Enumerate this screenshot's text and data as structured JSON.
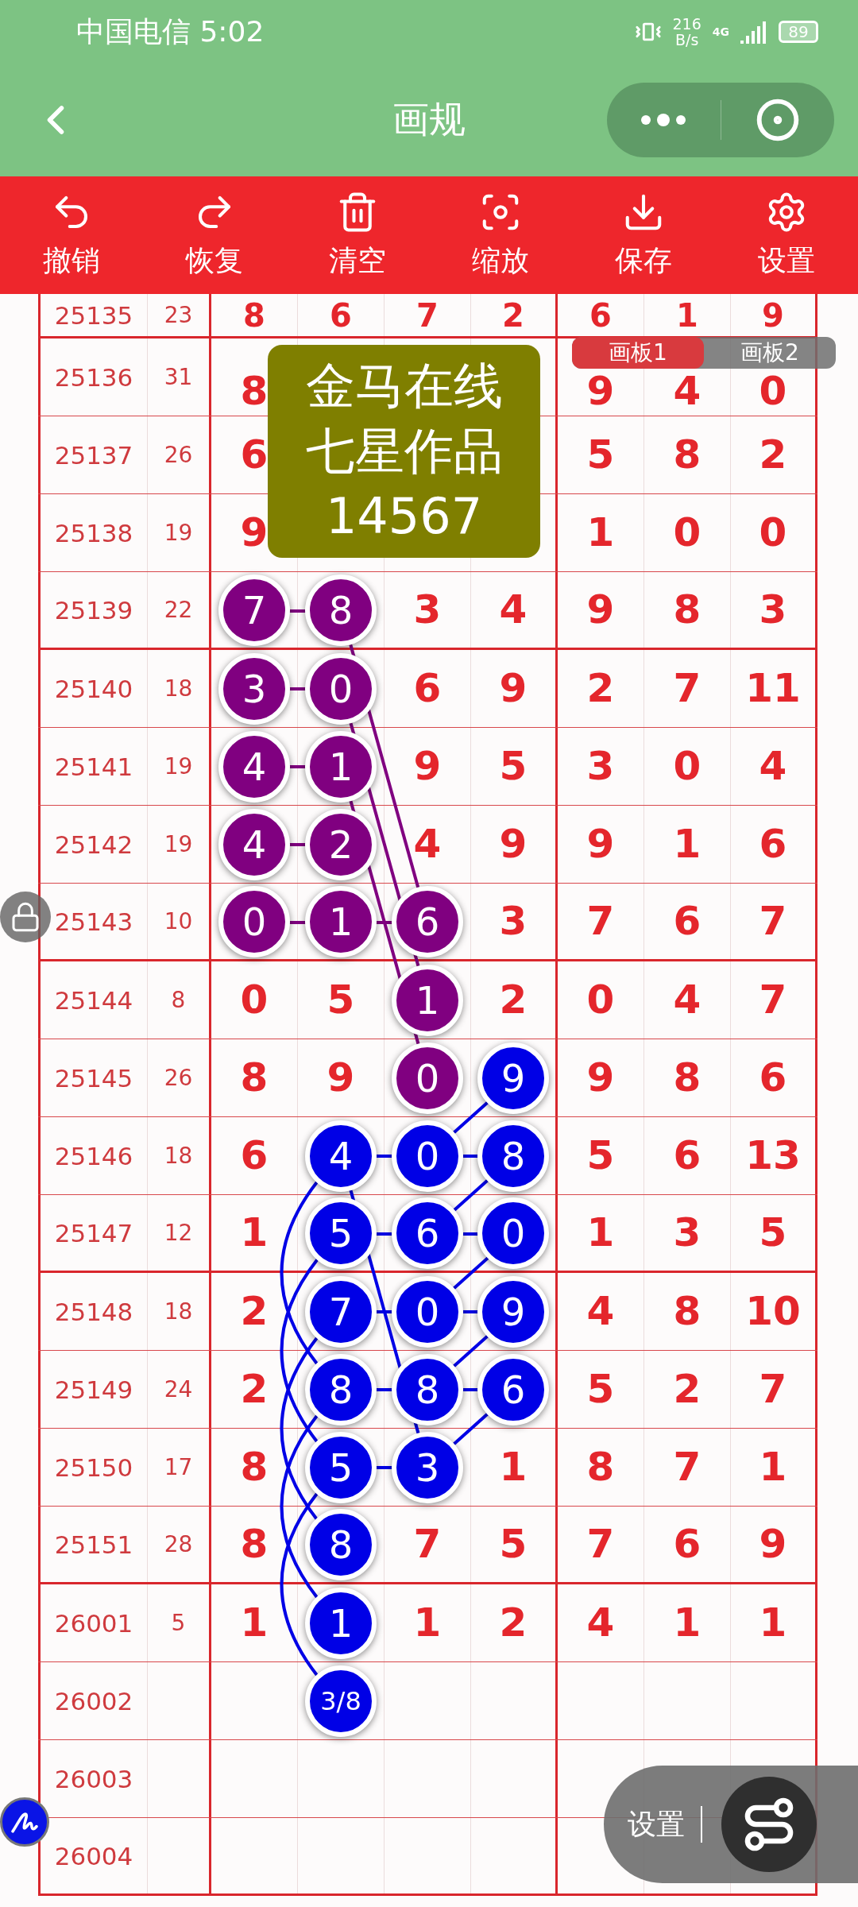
{
  "status_bar": {
    "carrier_time": "中国电信 5:02",
    "speed": "216",
    "speed_unit": "B/s",
    "network": "4G",
    "battery": "89"
  },
  "title_bar": {
    "title": "画规"
  },
  "toolbar": [
    {
      "kind": "undo",
      "label": "撤销"
    },
    {
      "kind": "redo",
      "label": "恢复"
    },
    {
      "kind": "clear",
      "label": "清空"
    },
    {
      "kind": "zoom",
      "label": "缩放"
    },
    {
      "kind": "save",
      "label": "保存"
    },
    {
      "kind": "settings",
      "label": "设置"
    }
  ],
  "board_tabs": [
    {
      "label": "画板1",
      "selected": true
    },
    {
      "label": "画板2",
      "selected": false
    }
  ],
  "note_card": {
    "lines": [
      "金马在线",
      "七星作品",
      "14567"
    ]
  },
  "rows": [
    {
      "issue": "25135",
      "sum": "23",
      "cells": [
        {
          "value": "8"
        },
        {
          "value": "6"
        },
        {
          "value": "7"
        },
        {
          "value": "2"
        },
        {
          "value": "6"
        },
        {
          "value": "1"
        },
        {
          "value": "9"
        }
      ]
    },
    {
      "issue": "25136",
      "sum": "31",
      "cells": [
        {
          "value": "8"
        },
        null,
        null,
        null,
        {
          "value": "9"
        },
        {
          "value": "4"
        },
        {
          "value": "0"
        }
      ]
    },
    {
      "issue": "25137",
      "sum": "26",
      "cells": [
        {
          "value": "6"
        },
        null,
        null,
        null,
        {
          "value": "5"
        },
        {
          "value": "8"
        },
        {
          "value": "2"
        }
      ]
    },
    {
      "issue": "25138",
      "sum": "19",
      "cells": [
        {
          "value": "9"
        },
        null,
        null,
        null,
        {
          "value": "1"
        },
        {
          "value": "0"
        },
        {
          "value": "0"
        }
      ]
    },
    {
      "issue": "25139",
      "sum": "22",
      "cells": [
        {
          "value": "7",
          "color": "#800080"
        },
        {
          "value": "8",
          "color": "#800080"
        },
        {
          "value": "3"
        },
        {
          "value": "4"
        },
        {
          "value": "9"
        },
        {
          "value": "8"
        },
        {
          "value": "3"
        }
      ]
    },
    {
      "issue": "25140",
      "sum": "18",
      "cells": [
        {
          "value": "3",
          "color": "#800080"
        },
        {
          "value": "0",
          "color": "#800080"
        },
        {
          "value": "6"
        },
        {
          "value": "9"
        },
        {
          "value": "2"
        },
        {
          "value": "7"
        },
        {
          "value": "11"
        }
      ]
    },
    {
      "issue": "25141",
      "sum": "19",
      "cells": [
        {
          "value": "4",
          "color": "#800080"
        },
        {
          "value": "1",
          "color": "#800080"
        },
        {
          "value": "9"
        },
        {
          "value": "5"
        },
        {
          "value": "3"
        },
        {
          "value": "0"
        },
        {
          "value": "4"
        }
      ]
    },
    {
      "issue": "25142",
      "sum": "19",
      "cells": [
        {
          "value": "4",
          "color": "#800080"
        },
        {
          "value": "2",
          "color": "#800080"
        },
        {
          "value": "4"
        },
        {
          "value": "9"
        },
        {
          "value": "9"
        },
        {
          "value": "1"
        },
        {
          "value": "6"
        }
      ]
    },
    {
      "issue": "25143",
      "sum": "10",
      "cells": [
        {
          "value": "0",
          "color": "#800080"
        },
        {
          "value": "1",
          "color": "#800080"
        },
        {
          "value": "6",
          "color": "#800080"
        },
        {
          "value": "3"
        },
        {
          "value": "7"
        },
        {
          "value": "6"
        },
        {
          "value": "7"
        }
      ]
    },
    {
      "issue": "25144",
      "sum": "8",
      "cells": [
        {
          "value": "0"
        },
        {
          "value": "5"
        },
        {
          "value": "1",
          "color": "#800080"
        },
        {
          "value": "2"
        },
        {
          "value": "0"
        },
        {
          "value": "4"
        },
        {
          "value": "7"
        }
      ]
    },
    {
      "issue": "25145",
      "sum": "26",
      "cells": [
        {
          "value": "8"
        },
        {
          "value": "9"
        },
        {
          "value": "0",
          "color": "#800080"
        },
        {
          "value": "9",
          "color": "#0000e6"
        },
        {
          "value": "9"
        },
        {
          "value": "8"
        },
        {
          "value": "6"
        }
      ]
    },
    {
      "issue": "25146",
      "sum": "18",
      "cells": [
        {
          "value": "6"
        },
        {
          "value": "4",
          "color": "#0000e6"
        },
        {
          "value": "0",
          "color": "#0000e6"
        },
        {
          "value": "8",
          "color": "#0000e6"
        },
        {
          "value": "5"
        },
        {
          "value": "6"
        },
        {
          "value": "13"
        }
      ]
    },
    {
      "issue": "25147",
      "sum": "12",
      "cells": [
        {
          "value": "1"
        },
        {
          "value": "5",
          "color": "#0000e6"
        },
        {
          "value": "6",
          "color": "#0000e6"
        },
        {
          "value": "0",
          "color": "#0000e6"
        },
        {
          "value": "1"
        },
        {
          "value": "3"
        },
        {
          "value": "5"
        }
      ]
    },
    {
      "issue": "25148",
      "sum": "18",
      "cells": [
        {
          "value": "2"
        },
        {
          "value": "7",
          "color": "#0000e6"
        },
        {
          "value": "0",
          "color": "#0000e6"
        },
        {
          "value": "9",
          "color": "#0000e6"
        },
        {
          "value": "4"
        },
        {
          "value": "8"
        },
        {
          "value": "10"
        }
      ]
    },
    {
      "issue": "25149",
      "sum": "24",
      "cells": [
        {
          "value": "2"
        },
        {
          "value": "8",
          "color": "#0000e6"
        },
        {
          "value": "8",
          "color": "#0000e6"
        },
        {
          "value": "6",
          "color": "#0000e6"
        },
        {
          "value": "5"
        },
        {
          "value": "2"
        },
        {
          "value": "7"
        }
      ]
    },
    {
      "issue": "25150",
      "sum": "17",
      "cells": [
        {
          "value": "8"
        },
        {
          "value": "5",
          "color": "#0000e6"
        },
        {
          "value": "3",
          "color": "#0000e6"
        },
        {
          "value": "1"
        },
        {
          "value": "8"
        },
        {
          "value": "7"
        },
        {
          "value": "1"
        }
      ]
    },
    {
      "issue": "25151",
      "sum": "28",
      "cells": [
        {
          "value": "8"
        },
        {
          "value": "8",
          "color": "#0000e6"
        },
        {
          "value": "7"
        },
        {
          "value": "5"
        },
        {
          "value": "7"
        },
        {
          "value": "6"
        },
        {
          "value": "9"
        }
      ]
    },
    {
      "issue": "26001",
      "sum": "5",
      "cells": [
        {
          "value": "1"
        },
        {
          "value": "1",
          "color": "#0000e6"
        },
        {
          "value": "1"
        },
        {
          "value": "2"
        },
        {
          "value": "4"
        },
        {
          "value": "1"
        },
        {
          "value": "1"
        }
      ]
    },
    {
      "issue": "26002",
      "cells": [
        null,
        {
          "value": "3/8",
          "color": "#0000e6"
        },
        null,
        null,
        null,
        null,
        null
      ]
    },
    {
      "issue": "26003",
      "cells": [
        null,
        null,
        null,
        null,
        null,
        null,
        null
      ]
    },
    {
      "issue": "26004",
      "cells": [
        null,
        null,
        null,
        null,
        null,
        null,
        null
      ]
    }
  ],
  "float_menu": {
    "label": "设置"
  }
}
